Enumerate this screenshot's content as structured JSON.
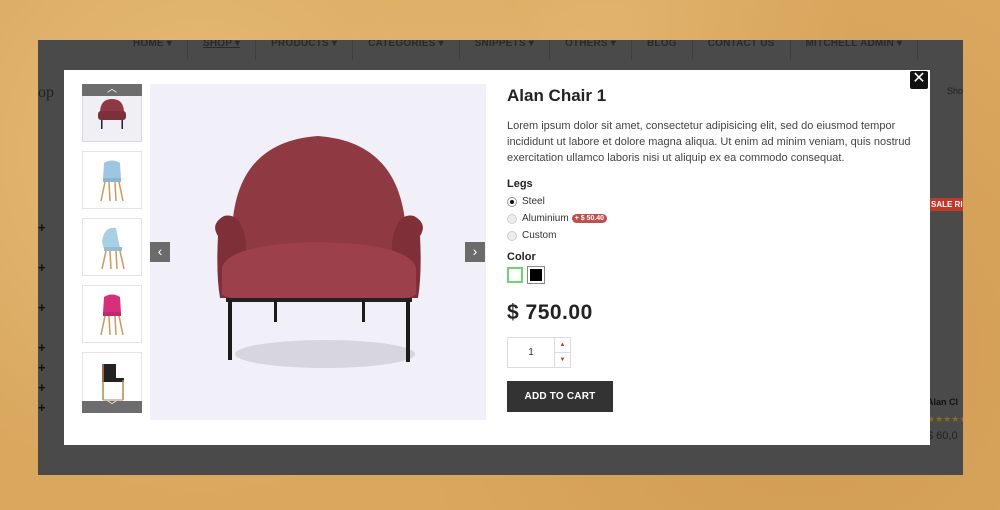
{
  "topnav": {
    "items": [
      "HOME ▾",
      "SHOP ▾",
      "PRODUCTS ▾",
      "CATEGORIES ▾",
      "SNIPPETS ▾",
      "OTHERS ▾",
      "BLOG",
      "CONTACT US",
      "MITCHELL ADMIN ▾"
    ],
    "active": "SHOP ▾"
  },
  "background": {
    "page_title_fragment": "op",
    "show_fragment": "Sho",
    "sale_ribbon": "SALE RIB",
    "product_name_fragment": "Alan Cl",
    "stars": "★★★★★",
    "price_fragment": "$ 60,0"
  },
  "modal": {
    "close_label": "✕",
    "thumbnails": [
      {
        "name": "red-armchair",
        "color": "#8e3a44"
      },
      {
        "name": "blue-eames-chair",
        "color": "#9fc6e0"
      },
      {
        "name": "light-blue-eames-chair",
        "color": "#a9cfe2"
      },
      {
        "name": "pink-eames-chair",
        "color": "#d6307a"
      },
      {
        "name": "black-wood-chair",
        "color": "#222222"
      }
    ],
    "thumb_up": "︿",
    "thumb_down": "﹀",
    "image_prev": "‹",
    "image_next": "›",
    "product": {
      "title": "Alan Chair 1",
      "description": "Lorem ipsum dolor sit amet, consectetur adipisicing elit, sed do eiusmod tempor incididunt ut labore et dolore magna aliqua. Ut enim ad minim veniam, quis nostrud exercitation ullamco laboris nisi ut aliquip ex ea commodo consequat.",
      "legs_label": "Legs",
      "legs_options": [
        {
          "label": "Steel",
          "checked": true,
          "extra": ""
        },
        {
          "label": "Aluminium",
          "checked": false,
          "extra": "+ $ 50.40"
        },
        {
          "label": "Custom",
          "checked": false,
          "extra": ""
        }
      ],
      "color_label": "Color",
      "colors": [
        "#ffffff",
        "#000000"
      ],
      "price": "$ 750.00",
      "quantity": "1",
      "qty_up": "▲",
      "qty_down": "▼",
      "add_to_cart": "ADD TO CART"
    }
  }
}
